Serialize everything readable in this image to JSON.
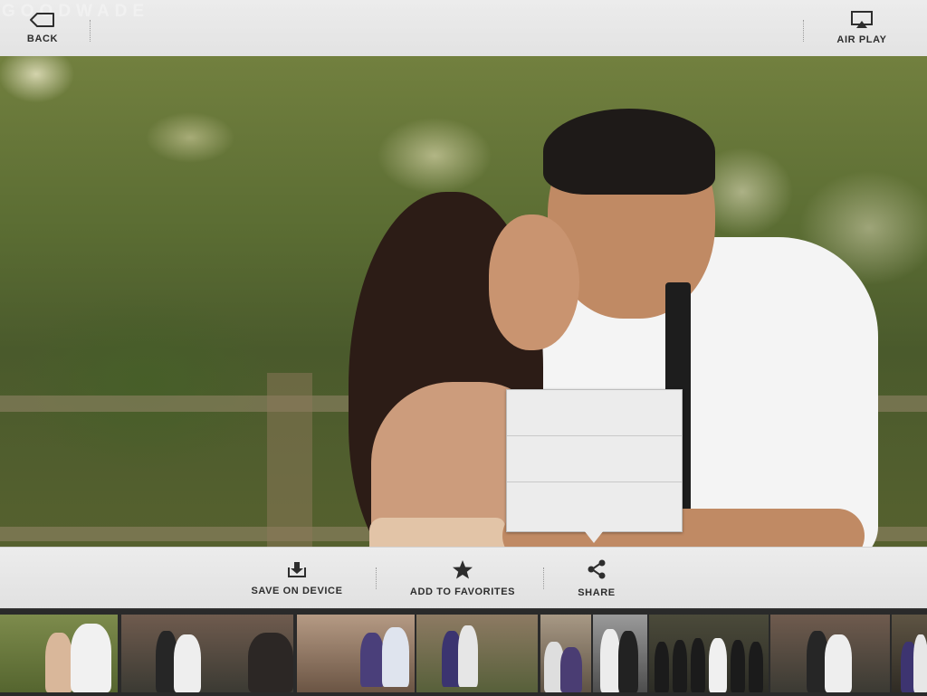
{
  "topbar": {
    "brand_watermark": "GOODWADE",
    "back_label": "BACK",
    "airplay_label": "AIR PLAY",
    "back_icon": "back-arrow-icon",
    "airplay_icon": "airplay-icon"
  },
  "photo": {
    "subject": "couple portrait"
  },
  "popover": {
    "rows": 3
  },
  "actions": {
    "save_label": "SAVE ON DEVICE",
    "save_icon": "download-icon",
    "favorites_label": "ADD TO FAVORITES",
    "favorites_icon": "star-icon",
    "share_label": "SHARE",
    "share_icon": "share-icon"
  },
  "colors": {
    "bar_bg": "#e6e6e6",
    "text": "#2d2d2d",
    "strip_bg": "#2a2a2a"
  },
  "thumbnails": [
    {
      "name": "thumb-couple-embrace"
    },
    {
      "name": "thumb-staircase-couple"
    },
    {
      "name": "thumb-portrait-couple"
    },
    {
      "name": "thumb-bench-couple"
    },
    {
      "name": "thumb-brick-wall-couple"
    },
    {
      "name": "thumb-archway-couple"
    },
    {
      "name": "thumb-bw-couple"
    },
    {
      "name": "thumb-bridal-party"
    },
    {
      "name": "thumb-staircase-couple-2"
    },
    {
      "name": "thumb-couple-partial"
    }
  ]
}
